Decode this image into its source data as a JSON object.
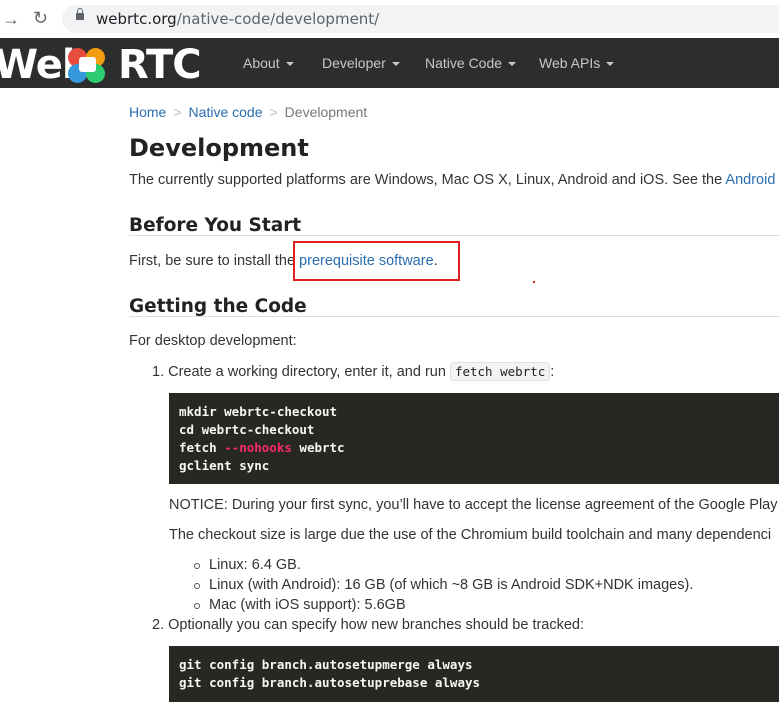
{
  "browser": {
    "url_domain": "webrtc.org",
    "url_path": "/native-code/development/"
  },
  "site": {
    "logo_left": "Web",
    "logo_right": "RTC",
    "menu": [
      {
        "label": "About"
      },
      {
        "label": "Developer"
      },
      {
        "label": "Native Code"
      },
      {
        "label": "Web APIs"
      }
    ]
  },
  "breadcrumb": {
    "home": "Home",
    "sep": ">",
    "section": "Native code",
    "current": "Development"
  },
  "page": {
    "title": "Development",
    "intro_text": "The currently supported platforms are Windows, Mac OS X, Linux, Android and iOS. See the ",
    "intro_link": "Android",
    "before_heading": "Before You Start",
    "before_text": "First, be sure to install the ",
    "before_link": "prerequisite software",
    "before_end": ".",
    "getting_heading": "Getting the Code",
    "desktop_text": "For desktop development:",
    "step1_num": "1.",
    "step1_text": "Create a working directory, enter it, and run ",
    "step1_code": "fetch webrtc",
    "step1_end": ":",
    "code1": {
      "line1": "mkdir webrtc-checkout",
      "line2": "cd webrtc-checkout",
      "line3_a": "fetch ",
      "line3_flag": "--nohooks",
      "line3_b": " webrtc",
      "line4": "gclient sync"
    },
    "notice_text": "NOTICE: During your first sync, you’ll have to accept the license agreement of the Google Play",
    "checkout_text": "The checkout size is large due the use of the Chromium build toolchain and many dependenci",
    "sizes": [
      "Linux: 6.4 GB.",
      "Linux (with Android): 16 GB (of which ~8 GB is Android SDK+NDK images).",
      "Mac (with iOS support): 5.6GB"
    ],
    "step2_num": "2.",
    "step2_text": "Optionally you can specify how new branches should be tracked:",
    "code2": {
      "line1": "git config branch.autosetupmerge always",
      "line2": "git config branch.autosetuprebase always"
    }
  },
  "colors": {
    "header_bg": "#2d2d2d",
    "link": "#2a6db0",
    "highlight": "#e02020",
    "code_bg": "#272822",
    "code_flag": "#f92672"
  },
  "icons": [
    "back-arrow-icon",
    "reload-icon",
    "lock-icon",
    "webrtc-logo-icon",
    "chevron-down-icon"
  ]
}
